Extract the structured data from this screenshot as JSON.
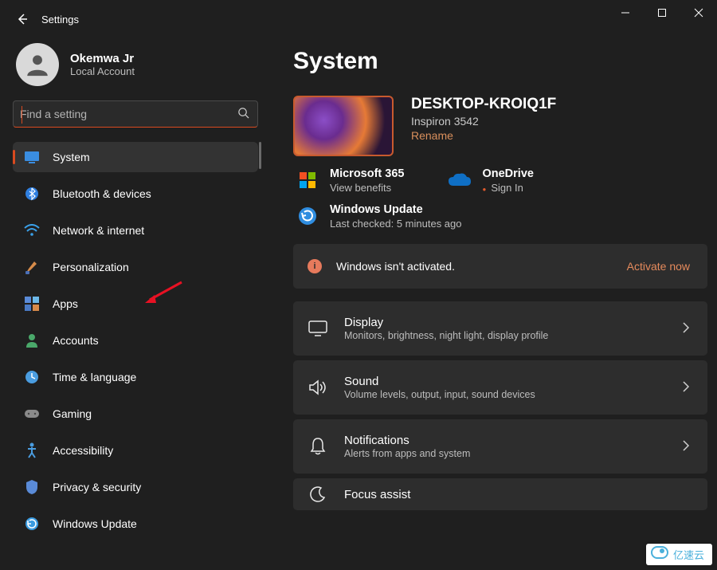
{
  "titlebar": {
    "back": "←",
    "title": "Settings"
  },
  "user": {
    "name": "Okemwa Jr",
    "account": "Local Account"
  },
  "search": {
    "placeholder": "Find a setting"
  },
  "nav": {
    "items": [
      {
        "id": "system",
        "label": "System",
        "selected": true
      },
      {
        "id": "bluetooth",
        "label": "Bluetooth & devices"
      },
      {
        "id": "network",
        "label": "Network & internet"
      },
      {
        "id": "personalization",
        "label": "Personalization"
      },
      {
        "id": "apps",
        "label": "Apps"
      },
      {
        "id": "accounts",
        "label": "Accounts"
      },
      {
        "id": "time",
        "label": "Time & language"
      },
      {
        "id": "gaming",
        "label": "Gaming"
      },
      {
        "id": "accessibility",
        "label": "Accessibility"
      },
      {
        "id": "privacy",
        "label": "Privacy & security"
      },
      {
        "id": "update",
        "label": "Windows Update"
      }
    ]
  },
  "page": {
    "title": "System",
    "device": {
      "name": "DESKTOP-KROIQ1F",
      "model": "Inspiron 3542",
      "rename": "Rename"
    },
    "services": {
      "m365": {
        "title": "Microsoft 365",
        "sub": "View benefits"
      },
      "onedrive": {
        "title": "OneDrive",
        "sub": "Sign In"
      },
      "update": {
        "title": "Windows Update",
        "sub": "Last checked: 5 minutes ago"
      }
    },
    "banner": {
      "text": "Windows isn't activated.",
      "action": "Activate now"
    },
    "cards": [
      {
        "id": "display",
        "title": "Display",
        "sub": "Monitors, brightness, night light, display profile"
      },
      {
        "id": "sound",
        "title": "Sound",
        "sub": "Volume levels, output, input, sound devices"
      },
      {
        "id": "notifications",
        "title": "Notifications",
        "sub": "Alerts from apps and system"
      },
      {
        "id": "focus",
        "title": "Focus assist",
        "sub": ""
      }
    ]
  },
  "watermark": "亿速云",
  "colors": {
    "accent": "#d94a1f",
    "link": "#e58a5c"
  }
}
